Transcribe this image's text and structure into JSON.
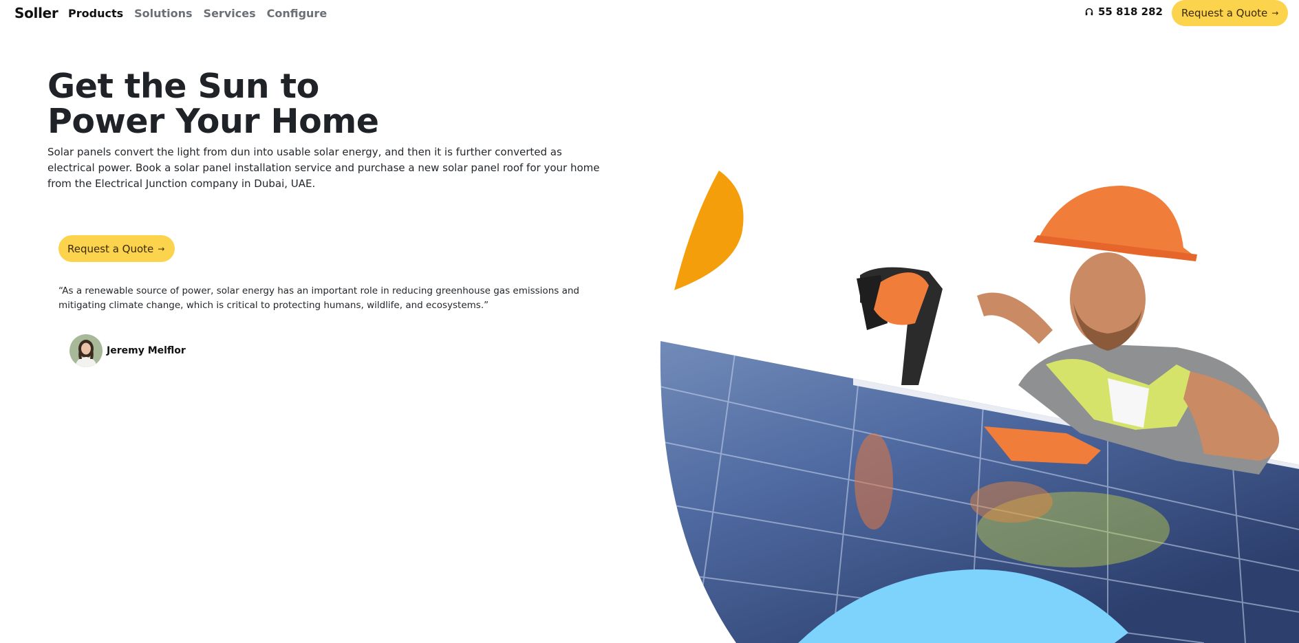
{
  "header": {
    "brand": "Soller",
    "nav": [
      {
        "label": "Products",
        "active": true
      },
      {
        "label": "Solutions",
        "active": false
      },
      {
        "label": "Services",
        "active": false
      },
      {
        "label": "Configure",
        "active": false
      }
    ],
    "phone": "55 818 282",
    "phone_icon": "headphones-icon",
    "cta_label": "Request a Quote"
  },
  "hero": {
    "title_line1": "Get the Sun to",
    "title_line2": "Power Your Home",
    "description": "Solar panels convert the light from dun into usable solar energy, and then it is further converted as electrical power. Book a solar panel installation service and purchase a new solar panel roof for your home from the Electrical Junction company in Dubai, UAE.",
    "cta_label": "Request a Quote",
    "cta_icon": "arrow-right-icon",
    "quote": "“As a renewable source of power, solar energy has an important role in reducing greenhouse gas emissions and mitigating climate change, which is critical to protecting humans, wildlife, and ecosystems.”",
    "author_name": "Jeremy Melflor"
  },
  "colors": {
    "accent_yellow": "#fcd34d",
    "accent_orange": "#f59e0b",
    "accent_sky": "#7dd3fc",
    "text_dark": "#1f2328"
  }
}
